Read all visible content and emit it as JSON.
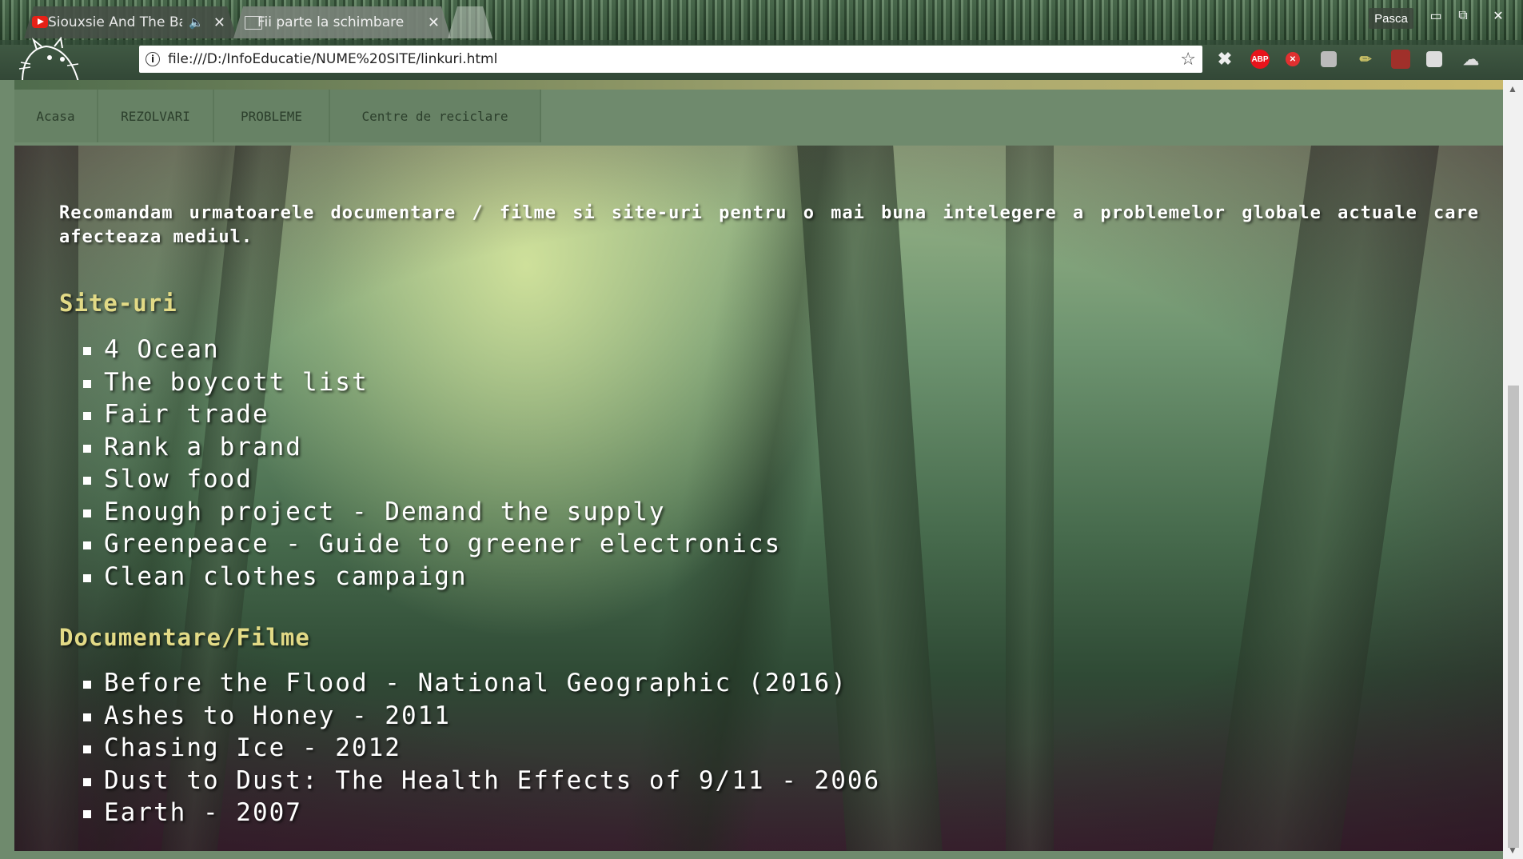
{
  "browser": {
    "tabs": [
      {
        "title": "Siouxsie And The Ba",
        "favicon": "youtube-icon",
        "audio": "speaker-icon"
      },
      {
        "title": "Fii parte la schimbare",
        "favicon": "document-icon"
      }
    ],
    "profile_name": "Pasca",
    "url": "file:///D:/InfoEducatie/NUME%20SITE/linkuri.html",
    "extensions": [
      {
        "name": "tools-icon",
        "color": "#e8e8e8"
      },
      {
        "name": "adblock-plus-icon",
        "label": "ABP",
        "color": "#e8141c"
      },
      {
        "name": "red-extension-icon",
        "color": "#e03030"
      },
      {
        "name": "lock-extension-icon",
        "color": "#bbbbbb"
      },
      {
        "name": "pencil-extension-icon",
        "color": "#c9c066"
      },
      {
        "name": "avatar-extension-icon",
        "color": "#a0302a"
      },
      {
        "name": "white-extension-icon",
        "color": "#dddddd"
      },
      {
        "name": "puzzle-extension-icon",
        "color": "#dddddd"
      }
    ]
  },
  "nav": {
    "items": [
      "Acasa",
      "REZOLVARI",
      "PROBLEME",
      "Centre de reciclare"
    ]
  },
  "content": {
    "intro": "Recomandam urmatoarele documentare / filme si site-uri pentru o mai buna intelegere a problemelor globale actuale care afecteaza mediul.",
    "sites_title": "Site-uri",
    "sites": [
      "4 Ocean",
      "The boycott list",
      "Fair trade",
      "Rank a brand",
      "Slow food",
      "Enough project - Demand the supply",
      "Greenpeace - Guide to greener electronics",
      "Clean clothes campaign"
    ],
    "films_title": "Documentare/Filme",
    "films": [
      "Before the Flood - National Geographic (2016)",
      "Ashes to Honey - 2011",
      "Chasing Ice - 2012",
      "Dust to Dust: The Health Effects of 9/11 - 2006",
      "Earth - 2007"
    ]
  },
  "colors": {
    "accent_title": "#e2da86",
    "nav_background": "#6f8a6d",
    "nav_text": "#2c3f2c"
  }
}
